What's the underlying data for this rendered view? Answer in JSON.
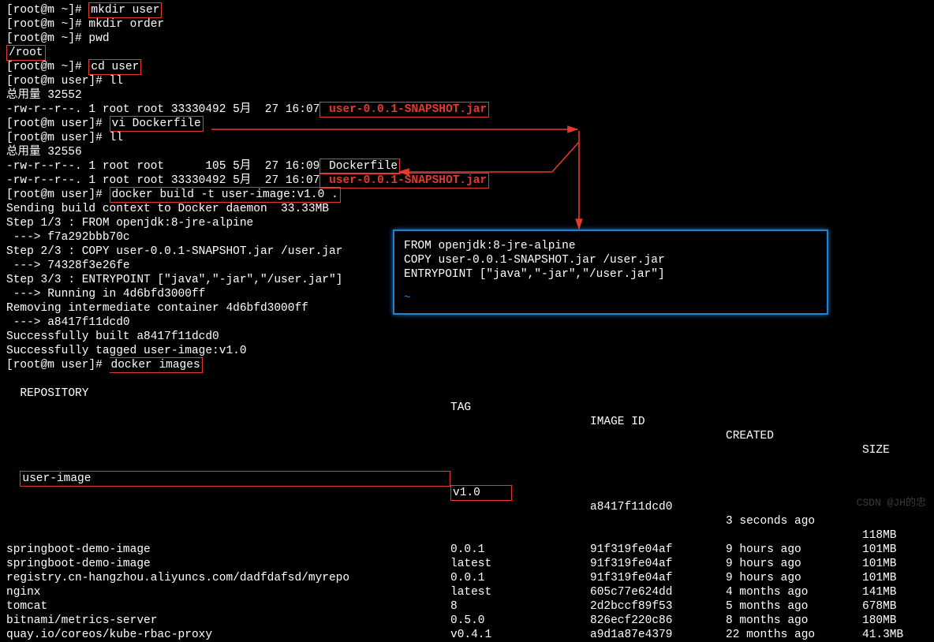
{
  "prompt_root": "[root@m ~]# ",
  "prompt_user": "[root@m user]# ",
  "cmd": {
    "mkdir_user": "mkdir user",
    "mkdir_order": "mkdir order",
    "pwd": "pwd",
    "pwd_out": "/root",
    "cd_user": "cd user",
    "ll": "ll",
    "vi": "vi Dockerfile",
    "build": "docker build -t user-image:v1.0 .",
    "images": "docker images"
  },
  "ls1": {
    "total": "总用量 32552",
    "row1_a": "-rw-r--r--. 1 root root 33330492 5月  27 16:07",
    "jar": " user-0.0.1-SNAPSHOT.jar"
  },
  "ls2": {
    "total": "总用量 32556",
    "row1": "-rw-r--r--. 1 root root      105 5月  27 16:09",
    "dockerfile": " Dockerfile",
    "row2": "-rw-r--r--. 1 root root 33330492 5月  27 16:07",
    "jar": " user-0.0.1-SNAPSHOT.jar"
  },
  "build_out": {
    "l1": "Sending build context to Docker daemon  33.33MB",
    "l2": "Step 1/3 : FROM openjdk:8-jre-alpine",
    "l3": " ---> f7a292bbb70c",
    "l4": "Step 2/3 : COPY user-0.0.1-SNAPSHOT.jar /user.jar",
    "l5": " ---> 74328f3e26fe",
    "l6": "Step 3/3 : ENTRYPOINT [\"java\",\"-jar\",\"/user.jar\"]",
    "l7": " ---> Running in 4d6bfd3000ff",
    "l8": "Removing intermediate container 4d6bfd3000ff",
    "l9": " ---> a8417f11dcd0",
    "l10": "Successfully built a8417f11dcd0",
    "l11": "Successfully tagged user-image:v1.0"
  },
  "editor": {
    "l1": "FROM openjdk:8-jre-alpine",
    "l2": "COPY user-0.0.1-SNAPSHOT.jar /user.jar",
    "l3": "ENTRYPOINT [\"java\",\"-jar\",\"/user.jar\"]",
    "tilde": "~"
  },
  "table": {
    "hdr": {
      "repo": "REPOSITORY",
      "tag": "TAG",
      "id": "IMAGE ID",
      "created": "CREATED",
      "size": "SIZE"
    },
    "rows": [
      {
        "repo": "user-image",
        "tag": "v1.0",
        "id": "a8417f11dcd0",
        "created": "3 seconds ago",
        "size": "118MB"
      },
      {
        "repo": "springboot-demo-image",
        "tag": "0.0.1",
        "id": "91f319fe04af",
        "created": "9 hours ago",
        "size": "101MB"
      },
      {
        "repo": "springboot-demo-image",
        "tag": "latest",
        "id": "91f319fe04af",
        "created": "9 hours ago",
        "size": "101MB"
      },
      {
        "repo": "registry.cn-hangzhou.aliyuncs.com/dadfdafsd/myrepo",
        "tag": "0.0.1",
        "id": "91f319fe04af",
        "created": "9 hours ago",
        "size": "101MB"
      },
      {
        "repo": "nginx",
        "tag": "latest",
        "id": "605c77e624dd",
        "created": "4 months ago",
        "size": "141MB"
      },
      {
        "repo": "tomcat",
        "tag": "8",
        "id": "2d2bccf89f53",
        "created": "5 months ago",
        "size": "678MB"
      },
      {
        "repo": "bitnami/metrics-server",
        "tag": "0.5.0",
        "id": "826ecf220c86",
        "created": "8 months ago",
        "size": "180MB"
      },
      {
        "repo": "quay.io/coreos/kube-rbac-proxy",
        "tag": "v0.4.1",
        "id": "a9d1a87e4379",
        "created": "22 months ago",
        "size": "41.3MB"
      }
    ]
  },
  "watermark": "CSDN @JH的忠"
}
